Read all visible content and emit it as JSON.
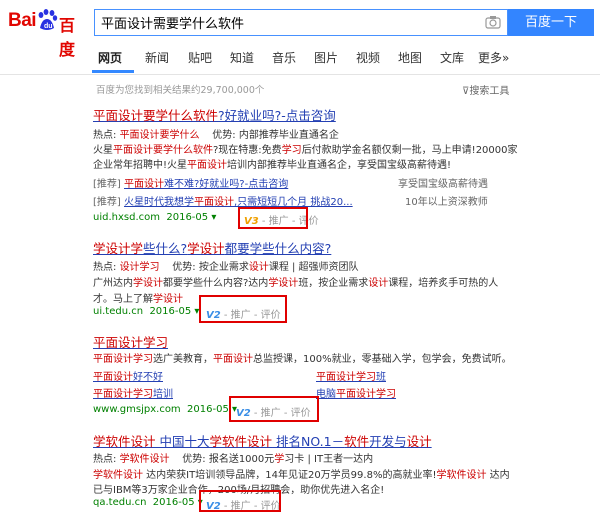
{
  "header": {
    "logo_bai": "Bai",
    "logo_du": "百度",
    "query": "平面设计需要学什么软件",
    "search_button": "百度一下"
  },
  "tabs": [
    "网页",
    "新闻",
    "贴吧",
    "知道",
    "音乐",
    "图片",
    "视频",
    "地图",
    "文库",
    "更多»"
  ],
  "result_count": "百度为您找到相关结果约29,700,000个",
  "tools_label": "搜索工具",
  "results": [
    {
      "title": "平面设计要学什么软件?好就业吗?-点击咨询",
      "line1": "热点: 平面设计要学什么  优势: 内部推荐毕业直通名企",
      "line2": "火星平面设计要学什么软件?现在特惠:免费学习后付款助学金名额仅剩一批，马上申请!20000家",
      "line3": "企业常年招聘中!火星平面设计培训内部推荐毕业直通名企，享受国宝级高薪待遇!",
      "rec1_label": "[推荐]",
      "rec1_link": "平面设计难不难?好就业吗?-点击咨询",
      "rec1_note": "享受国宝级高薪待遇",
      "rec2_label": "[推荐]",
      "rec2_link": "火星时代我想学平面设计,只需短短几个月 挑战20...",
      "rec2_note": "10年以上资深教师",
      "url": "uid.hxsd.com",
      "date": "2016-05",
      "badge": "V3",
      "tag": "- 推广 - 评价"
    },
    {
      "title": "学设计学些什么?学设计都要学些什么内容?",
      "line1": "热点: 设计学习  优势: 按企业需求设计课程 | 超强师资团队",
      "line2": "广州达内学设计都要学些什么内容?达内学设计班，按企业需求设计课程，培养实手可热的人",
      "line3": "才。马上了解学设计",
      "url": "ui.tedu.cn",
      "date": "2016-05",
      "badge": "V2",
      "tag": "- 推广 - 评价"
    },
    {
      "title": "平面设计学习",
      "line1": "平面设计学习选广美教育，平面设计总监授课，100%就业，零基础入学，包学会，免费试听。",
      "links": [
        "平面设计好不好",
        "平面设计学习班",
        "平面设计学习培训",
        "电脑平面设计学习"
      ],
      "url": "www.gmsjpx.com",
      "date": "2016-05",
      "badge": "V2",
      "tag": "- 推广 - 评价"
    },
    {
      "title": "学软件设计 中国十大学软件设计 排名NO.1－软件开发与设计",
      "line1": "热点: 学软件设计  优势: 报名送1000元学习卡 | IT王者一达内",
      "line2": "学软件设计 达内荣获IT培训领导品牌，14年见证20万学员99.8%的高就业率!学软件设计 达内",
      "line3": "已与IBM等3万家企业合作，200场/月招聘会，助你优先进入名企!",
      "url": "qa.tedu.cn",
      "date": "2016-05",
      "badge": "V2",
      "tag": "- 推广 - 评价"
    }
  ]
}
